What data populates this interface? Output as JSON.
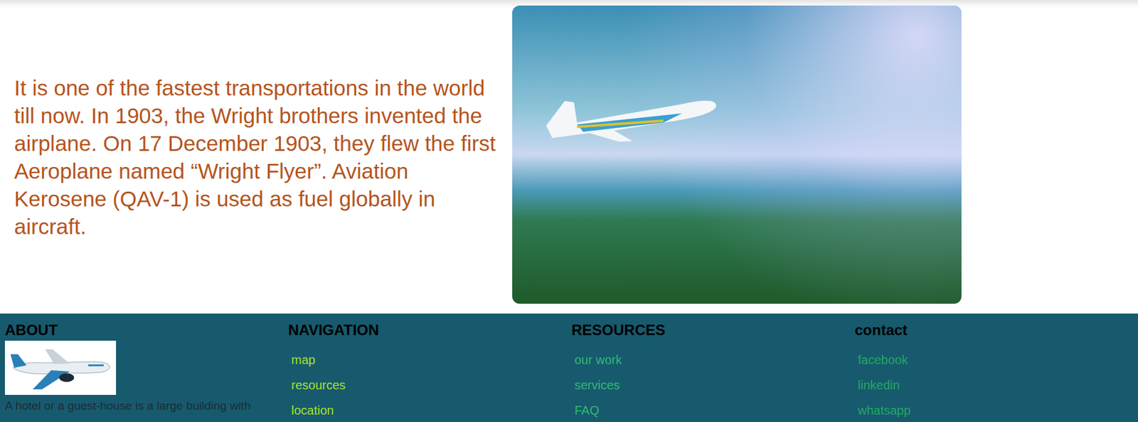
{
  "hero": {
    "text": "It is one of the fastest transportations in the world till now. In 1903, the Wright brothers invented the airplane. On 17 December 1903, they flew the first Aeroplane named “Wright Flyer”. Aviation Kerosene (QAV-1) is used as fuel globally in aircraft."
  },
  "footer": {
    "about": {
      "heading": "ABOUT",
      "text": "A hotel or a guest-house is a large building with"
    },
    "columns": [
      {
        "heading": "NAVIGATION",
        "links": [
          "map",
          "resources",
          "location"
        ]
      },
      {
        "heading": "RESOURCES",
        "links": [
          "our work",
          "services",
          "FAQ"
        ]
      },
      {
        "heading": "contact",
        "links": [
          "facebook",
          "linkedin",
          "whatsapp"
        ]
      }
    ]
  }
}
